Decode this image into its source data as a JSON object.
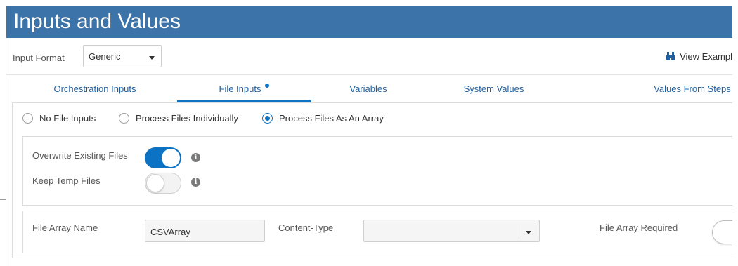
{
  "title": "Inputs and Values",
  "input_format": {
    "label": "Input Format",
    "value": "Generic"
  },
  "view_examples": {
    "label": "View Exampl"
  },
  "tabs": [
    {
      "label": "Orchestration Inputs",
      "active": false
    },
    {
      "label": "File Inputs",
      "active": true
    },
    {
      "label": "Variables",
      "active": false
    },
    {
      "label": "System Values",
      "active": false
    },
    {
      "label": "Values From Steps",
      "active": false
    }
  ],
  "file_input_modes": [
    {
      "label": "No File Inputs",
      "selected": false
    },
    {
      "label": "Process Files Individually",
      "selected": false
    },
    {
      "label": "Process Files As An Array",
      "selected": true
    }
  ],
  "options": {
    "overwrite_existing": {
      "label": "Overwrite Existing Files",
      "on": true
    },
    "keep_temp": {
      "label": "Keep Temp Files",
      "on": false
    }
  },
  "file_array": {
    "name_label": "File Array Name",
    "name_value": "CSVArray",
    "content_type_label": "Content-Type",
    "content_type_value": "",
    "required_label": "File Array Required"
  },
  "colors": {
    "title_bar": "#3c73a8",
    "accent": "#0b72c4",
    "tab_text": "#1f5f9f"
  },
  "icons": {
    "view_examples": "binoculars-icon",
    "info": "info-icon",
    "dropdown": "caret-down-icon"
  }
}
